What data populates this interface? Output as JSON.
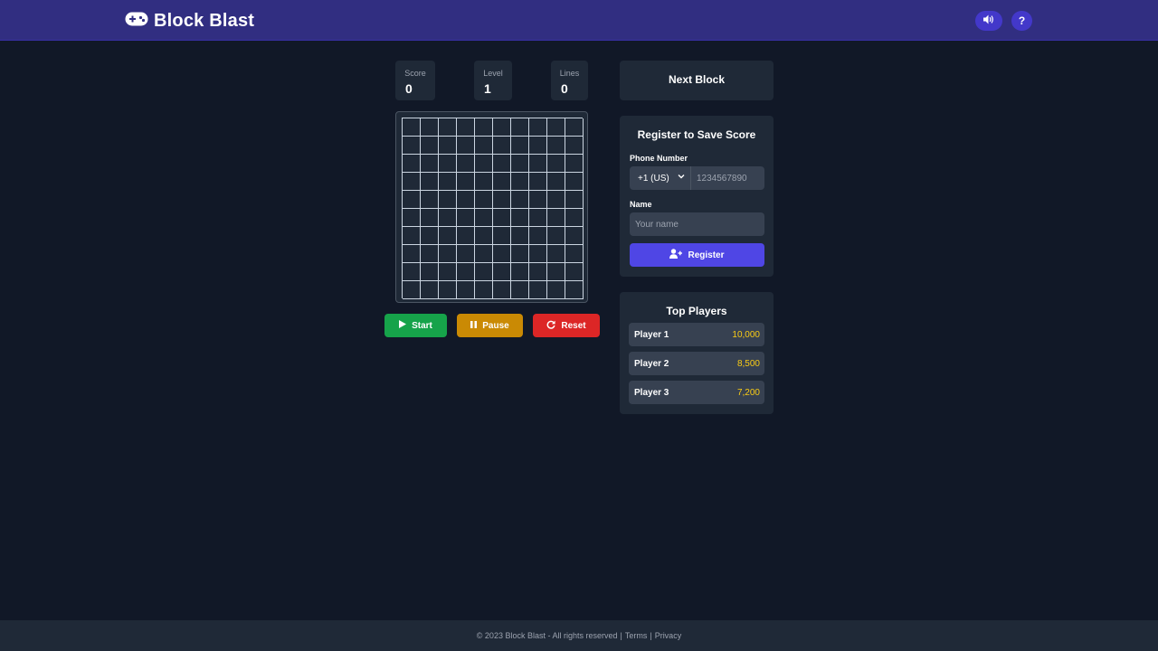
{
  "header": {
    "logo_icon": "gamepad-icon",
    "title": "Block Blast",
    "sound_icon": "volume-icon",
    "help_label": "?"
  },
  "stats": {
    "score_label": "Score",
    "score_value": "0",
    "level_label": "Level",
    "level_value": "1",
    "lines_label": "Lines",
    "lines_value": "0"
  },
  "board": {
    "rows": 10,
    "cols": 10
  },
  "controls": {
    "start_label": "Start",
    "pause_label": "Pause",
    "reset_label": "Reset"
  },
  "next_block": {
    "title": "Next Block"
  },
  "register": {
    "title": "Register to Save Score",
    "phone_label": "Phone Number",
    "country_code": "+1 (US)",
    "phone_placeholder": "1234567890",
    "name_label": "Name",
    "name_placeholder": "Your name",
    "button_label": "Register"
  },
  "top_players": {
    "title": "Top Players",
    "players": [
      {
        "name": "Player 1",
        "score": "10,000"
      },
      {
        "name": "Player 2",
        "score": "8,500"
      },
      {
        "name": "Player 3",
        "score": "7,200"
      }
    ]
  },
  "footer": {
    "copyright": "© 2023 Block Blast - All rights reserved",
    "terms": "Terms",
    "privacy": "Privacy"
  },
  "colors": {
    "header_bg": "#312e81",
    "page_bg": "#111827",
    "panel_bg": "#1f2937",
    "start": "#16a34a",
    "pause": "#ca8a04",
    "reset": "#dc2626",
    "register": "#4f46e5",
    "score_text": "#facc15"
  }
}
